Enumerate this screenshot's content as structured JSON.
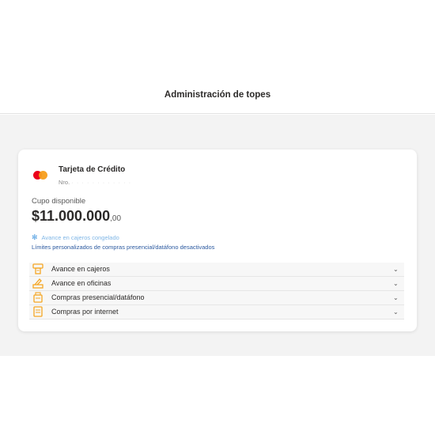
{
  "header": {
    "title": "Administración de topes"
  },
  "card": {
    "name": "Tarjeta de Crédito",
    "number_prefix": "Nro.",
    "number_masked": "· · · · · · · · · · · ·",
    "cupo_label": "Cupo disponible",
    "cupo_amount": "$11.000.000",
    "cupo_cents": ",00"
  },
  "status": {
    "frozen_icon": "snowflake-icon",
    "frozen_text": "Avance en cajeros congelado",
    "limits_text": "Límites personalizados de compras presencial/datáfono desactivados"
  },
  "menu": {
    "items": [
      {
        "label": "Avance en cajeros",
        "icon": "atm-icon"
      },
      {
        "label": "Avance en oficinas",
        "icon": "office-icon"
      },
      {
        "label": "Compras presencial/datáfono",
        "icon": "pos-terminal-icon"
      },
      {
        "label": "Compras por internet",
        "icon": "online-purchase-icon"
      }
    ]
  },
  "colors": {
    "accent_icon": "#f5a623",
    "frozen_text": "#7fb6e6",
    "limits_text": "#2c5aa0",
    "mastercard_red": "#eb001b",
    "mastercard_orange": "#f79e1b"
  }
}
